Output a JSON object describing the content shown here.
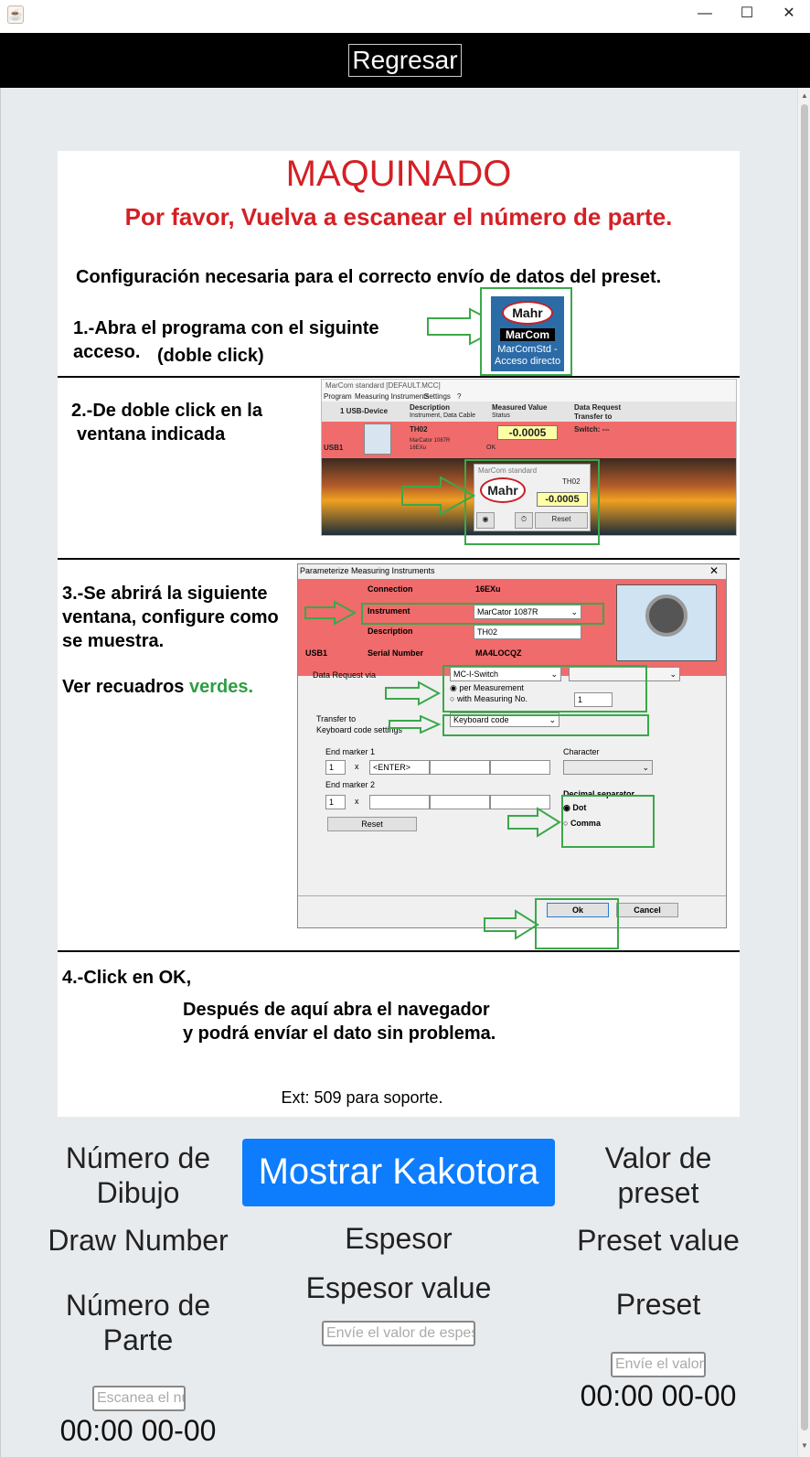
{
  "window": {
    "minimize_glyph": "—",
    "maximize_glyph": "☐",
    "close_glyph": "✕",
    "app_icon": "java-cup-icon"
  },
  "topbar": {
    "back_label": "Regresar"
  },
  "panel": {
    "title": "MAQUINADO",
    "subtitle": "Por favor, Vuelva a escanear el número de parte.",
    "config_heading": "Configuración necesaria para el correcto envío de datos del preset.",
    "step1_line1": "1.-Abra el programa con el siguinte",
    "step1_line2": "acceso.",
    "step1_hint": "(doble click)",
    "shortcut_logo": "Mahr",
    "shortcut_brand": "MarCom",
    "shortcut_label": "MarComStd - Acceso directo",
    "step2_line1": "2.-De doble click en la",
    "step2_line2": "ventana indicada",
    "step3_line1": "3.-Se abrirá la siguiente",
    "step3_line2": "ventana, configure como",
    "step3_line3": "se muestra.",
    "step3_note": "Ver recuadros",
    "step3_note_green": "verdes.",
    "step4": "4.-Click en OK,",
    "after_line1": "Después de aquí abra el navegador",
    "after_line2": "y podrá envíar el dato sin problema.",
    "ext": "Ext: 509 para soporte."
  },
  "ss2": {
    "window_title": "MarCom standard   [DEFAULT.MCC]",
    "menu": [
      "Program",
      "Measuring Instruments",
      "Settings",
      "?"
    ],
    "usb": "1 USB-Device",
    "col_description": "Description",
    "col_description_sub": "Instrument, Data Cable",
    "col_measured": "Measured Value",
    "col_status": "Status",
    "col_request": "Data Request",
    "col_transfer": "Transfer to",
    "device": "TH02",
    "device_model": "MarCator 1087R",
    "device_cable": "16EXu",
    "value": "-0.0005",
    "switch": "Switch: ---",
    "ok": "OK",
    "usb1": "USB1",
    "popup_title": "MarCom standard",
    "popup_device": "TH02",
    "popup_logo": "Mahr",
    "popup_value": "-0.0005",
    "popup_reset": "Reset"
  },
  "ss3": {
    "window_title": "Parameterize Measuring Instruments",
    "connection_label": "Connection",
    "connection_value": "16EXu",
    "instrument_label": "Instrument",
    "instrument_value": "MarCator 1087R",
    "description_label": "Description",
    "description_value": "TH02",
    "usb1": "USB1",
    "serial_label": "Serial Number",
    "serial_value": "MA4LOCQZ",
    "request_label": "Data Request via",
    "request_value": "MC-I-Switch",
    "per_measurement": "per Measurement",
    "with_measuring": "with Measuring No.",
    "measuring_no": "1",
    "transfer_label": "Transfer to",
    "transfer_value": "Keyboard code",
    "keyboard_settings": "Keyboard code settings",
    "end_marker1": "End marker 1",
    "end_marker1_count": "1",
    "end_marker1_value": "<ENTER>",
    "character_label": "Character",
    "end_marker2": "End marker 2",
    "end_marker2_count": "1",
    "times": "x",
    "decimal_label": "Decimal separator",
    "dot": "Dot",
    "comma": "Comma",
    "reset": "Reset",
    "ok": "Ok",
    "cancel": "Cancel"
  },
  "bottom": {
    "numero_dibujo": "Número de Dibujo",
    "mostrar": "Mostrar Kakotora",
    "valor_preset": "Valor de preset",
    "draw_number": "Draw Number",
    "espesor": "Espesor",
    "preset_value": "Preset value",
    "numero_parte": "Número de Parte",
    "espesor_value": "Espesor value",
    "preset": "Preset",
    "espesor_placeholder": "Envíe el valor de espesor",
    "preset_placeholder": "Envíe el valor",
    "parte_placeholder": "Escanea el número",
    "time_preset": "00:00 00-00",
    "time_parte": "00:00 00-00"
  }
}
